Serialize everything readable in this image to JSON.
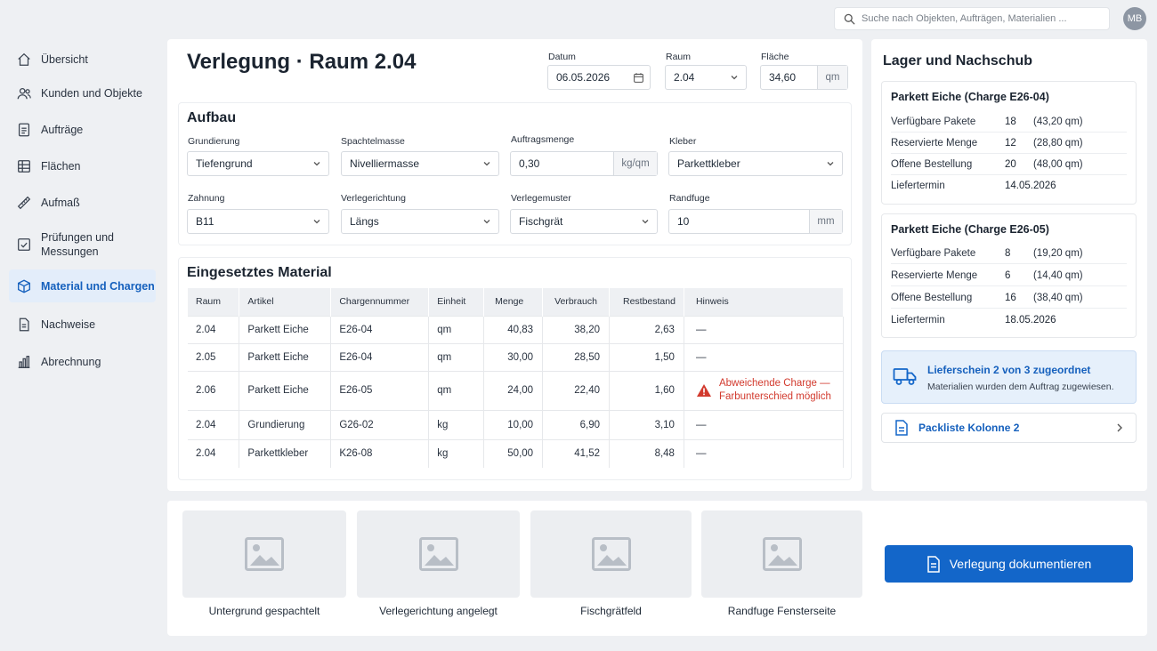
{
  "topbar": {
    "search_placeholder": "Suche nach Objekten, Aufträgen, Materialien ...",
    "avatar": "MB"
  },
  "sidebar": {
    "items": [
      {
        "label": "Übersicht",
        "icon": "home-icon"
      },
      {
        "label": "Kunden und Objekte",
        "icon": "users-icon"
      },
      {
        "label": "Aufträge",
        "icon": "document-icon"
      },
      {
        "label": "Flächen",
        "icon": "grid-icon"
      },
      {
        "label": "Aufmaß",
        "icon": "ruler-icon"
      },
      {
        "label": "Prüfungen und Messungen",
        "icon": "checkbox-icon"
      },
      {
        "label": "Material und Chargen",
        "icon": "box-icon",
        "active": true
      },
      {
        "label": "Nachweise",
        "icon": "document-icon"
      },
      {
        "label": "Abrechnung",
        "icon": "bar-chart-icon"
      }
    ]
  },
  "header": {
    "title": "Verlegung · Raum 2.04",
    "date_label": "Datum",
    "date_value": "06.05.2026",
    "room_label": "Raum",
    "room_value": "2.04",
    "area_label": "Fläche",
    "area_value": "34,60",
    "area_unit": "qm"
  },
  "aufbau": {
    "title": "Aufbau",
    "grundierung_label": "Grundierung",
    "grundierung_value": "Tiefengrund",
    "spachtel_label": "Spachtelmasse",
    "spachtel_value": "Nivelliermasse",
    "menge_label": "Auftragsmenge",
    "menge_value": "0,30",
    "menge_unit": "kg/qm",
    "kleber_label": "Kleber",
    "kleber_value": "Parkettkleber",
    "zahnung_label": "Zahnung",
    "zahnung_value": "B11",
    "richtung_label": "Verlegerichtung",
    "richtung_value": "Längs",
    "muster_label": "Verlegemuster",
    "muster_value": "Fischgrät",
    "randfuge_label": "Randfuge",
    "randfuge_value": "10",
    "randfuge_unit": "mm"
  },
  "material": {
    "title": "Eingesetztes Material",
    "columns": [
      "Raum",
      "Artikel",
      "Chargennummer",
      "Einheit",
      "Menge",
      "Verbrauch",
      "Restbestand",
      "Hinweis"
    ],
    "rows": [
      {
        "raum": "2.04",
        "artikel": "Parkett Eiche",
        "charge": "E26-04",
        "einheit": "qm",
        "menge": "40,83",
        "verbrauch": "38,20",
        "rest": "2,63",
        "hinweis": "—",
        "warn": false
      },
      {
        "raum": "2.05",
        "artikel": "Parkett Eiche",
        "charge": "E26-04",
        "einheit": "qm",
        "menge": "30,00",
        "verbrauch": "28,50",
        "rest": "1,50",
        "hinweis": "—",
        "warn": false
      },
      {
        "raum": "2.06",
        "artikel": "Parkett Eiche",
        "charge": "E26-05",
        "einheit": "qm",
        "menge": "24,00",
        "verbrauch": "22,40",
        "rest": "1,60",
        "hinweis": "Abweichende Charge — Farbunterschied möglich",
        "warn": true
      },
      {
        "raum": "2.04",
        "artikel": "Grundierung",
        "charge": "G26-02",
        "einheit": "kg",
        "menge": "10,00",
        "verbrauch": "6,90",
        "rest": "3,10",
        "hinweis": "—",
        "warn": false
      },
      {
        "raum": "2.04",
        "artikel": "Parkettkleber",
        "charge": "K26-08",
        "einheit": "kg",
        "menge": "50,00",
        "verbrauch": "41,52",
        "rest": "8,48",
        "hinweis": "—",
        "warn": false
      }
    ]
  },
  "lager": {
    "title": "Lager und Nachschub",
    "boxes": [
      {
        "title": "Parkett Eiche (Charge E26-04)",
        "rows": [
          {
            "k": "Verfügbare Pakete",
            "n": "18",
            "q": "(43,20 qm)"
          },
          {
            "k": "Reservierte Menge",
            "n": "12",
            "q": "(28,80 qm)"
          },
          {
            "k": "Offene Bestellung",
            "n": "20",
            "q": "(48,00 qm)"
          },
          {
            "k": "Liefertermin",
            "n": "14.05.2026",
            "q": ""
          }
        ]
      },
      {
        "title": "Parkett Eiche (Charge E26-05)",
        "rows": [
          {
            "k": "Verfügbare Pakete",
            "n": "8",
            "q": "(19,20 qm)"
          },
          {
            "k": "Reservierte Menge",
            "n": "6",
            "q": "(14,40 qm)"
          },
          {
            "k": "Offene Bestellung",
            "n": "16",
            "q": "(38,40 qm)"
          },
          {
            "k": "Liefertermin",
            "n": "18.05.2026",
            "q": ""
          }
        ]
      }
    ],
    "info_title": "Lieferschein 2 von 3 zugeordnet",
    "info_text": "Materialien wurden dem Auftrag zugewiesen.",
    "packliste": "Packliste Kolonne 2"
  },
  "photos": [
    {
      "caption": "Untergrund gespachtelt"
    },
    {
      "caption": "Verlegerichtung angelegt"
    },
    {
      "caption": "Fischgrätfeld"
    },
    {
      "caption": "Randfuge Fensterseite"
    }
  ],
  "document_button": "Verlegung dokumentieren",
  "colors": {
    "accent": "#1366c9",
    "active_bg": "#e3edfa",
    "warning": "#d23a2e"
  }
}
